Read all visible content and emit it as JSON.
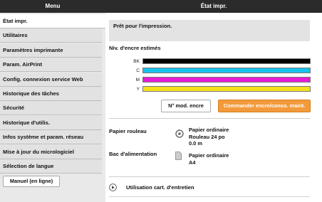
{
  "header": {
    "menu_title": "Menu",
    "status_title": "État impr."
  },
  "sidebar": {
    "items": [
      {
        "label": "État impr."
      },
      {
        "label": "Utilitaires"
      },
      {
        "label": "Paramètres imprimante"
      },
      {
        "label": "Param. AirPrint"
      },
      {
        "label": "Config. connexion service Web"
      },
      {
        "label": "Historique des tâches"
      },
      {
        "label": "Sécurité"
      },
      {
        "label": "Historique d'utilis."
      },
      {
        "label": "Infos système et param. réseau"
      },
      {
        "label": "Mise à jour du micrologiciel"
      },
      {
        "label": "Sélection de langue"
      }
    ],
    "manual_button": "Manuel (en ligne)"
  },
  "main": {
    "status_message": "Prêt pour l'impression.",
    "ink_title": "Niv. d'encre estimés",
    "inks": [
      {
        "label": "BK",
        "color": "#000000",
        "level": 1.0
      },
      {
        "label": "C",
        "color": "#16c1ea",
        "level": 1.0
      },
      {
        "label": "M",
        "color": "#e81ad8",
        "level": 1.0
      },
      {
        "label": "Y",
        "color": "#f5e21a",
        "level": 1.0
      }
    ],
    "model_button": "N° mod. encre",
    "order_button": "Commander encre/conso. maint.",
    "paper_roll": {
      "label": "Papier rouleau",
      "line1": "Papier ordinaire",
      "line2": "Rouleau 24 po",
      "line3": "0.0 m"
    },
    "feed_tray": {
      "label": "Bac d'alimentation",
      "line1": "Papier ordinaire",
      "line2": "A4"
    },
    "maintenance_link": "Utilisation cart. d'entretien"
  }
}
